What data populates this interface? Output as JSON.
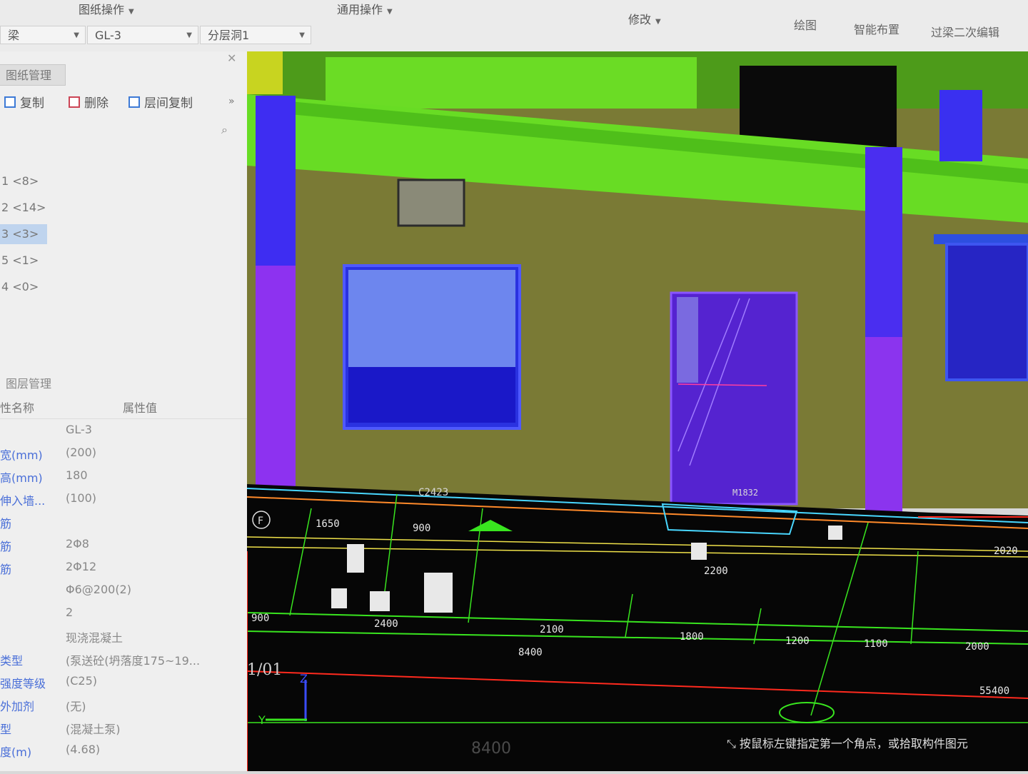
{
  "ribbon": {
    "groups": [
      "图纸操作",
      "通用操作",
      "修改"
    ],
    "buttons": [
      "绘图",
      "智能布置",
      "过梁二次编辑"
    ],
    "combos": [
      "梁",
      "GL-3",
      "分层洞1"
    ]
  },
  "left_panel": {
    "tab_title": "图纸管理",
    "toolbar": [
      "复制",
      "删除",
      "层间复制"
    ],
    "more": "»",
    "tree": [
      {
        "label": "1 <8>",
        "selected": false
      },
      {
        "label": "2 <14>",
        "selected": false
      },
      {
        "label": "3 <3>",
        "selected": true
      },
      {
        "label": "5 <1>",
        "selected": false
      },
      {
        "label": "4 <0>",
        "selected": false
      }
    ],
    "section_title": "图层管理",
    "prop_headers": [
      "性名称",
      "属性值"
    ],
    "props": [
      {
        "k": "",
        "v": "GL-3"
      },
      {
        "k": "宽(mm)",
        "v": "(200)"
      },
      {
        "k": "高(mm)",
        "v": "180"
      },
      {
        "k": "伸入墙...",
        "v": "(100)"
      },
      {
        "k": "筋",
        "v": ""
      },
      {
        "k": "筋",
        "v": "2Φ8"
      },
      {
        "k": "筋",
        "v": "2Φ12"
      },
      {
        "k": "",
        "v": "Φ6@200(2)"
      },
      {
        "k": "",
        "v": "2"
      },
      {
        "k": "",
        "v": "现浇混凝土"
      },
      {
        "k": "类型",
        "v": "(泵送砼(坍落度175~19..."
      },
      {
        "k": "强度等级",
        "v": "(C25)"
      },
      {
        "k": "外加剂",
        "v": "(无)"
      },
      {
        "k": "型",
        "v": "(混凝土泵)"
      },
      {
        "k": "度(m)",
        "v": "(4.68)"
      }
    ]
  },
  "viewport": {
    "labels_3d": {
      "window": "C2423",
      "door": "M1832",
      "axis": "F"
    },
    "dims_top": [
      "1650",
      "900",
      "2200"
    ],
    "dims_mid": [
      "900",
      "2400",
      "2100",
      "1800",
      "1200",
      "1100",
      "2000"
    ],
    "dim_total": "8400",
    "dim_overall": "55400",
    "dim_right_top": "2020",
    "axis_bottom": "1/01",
    "axis_z": "Z",
    "axis_y": "Y",
    "bottom_dim": "8400",
    "status_text": "按鼠标左键指定第一个角点，或拾取构件图元"
  },
  "colors": {
    "beam": "#62dd22",
    "column": "#3c2ef0",
    "wall": "#6b6a2e",
    "cad_bg": "#050505",
    "cad_line": "#39e51f",
    "cad_red": "#ff2a1e",
    "selection": "#4f8bd8"
  }
}
